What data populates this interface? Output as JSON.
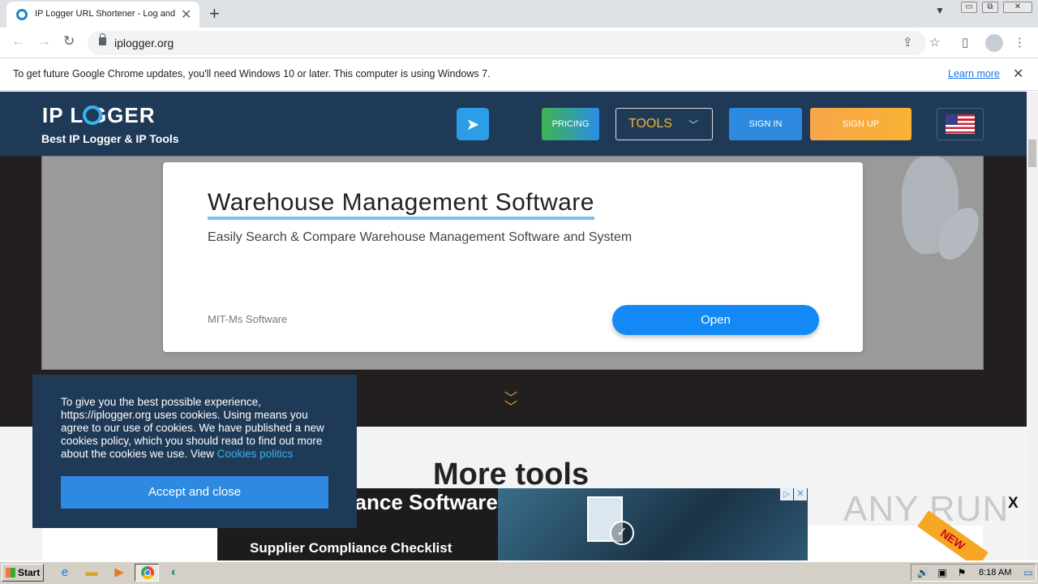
{
  "browser": {
    "tab_title": "IP Logger URL Shortener - Log and T",
    "tab_close": "✕",
    "new_tab": "+",
    "url": "iplogger.org",
    "window_controls": {
      "minimize": "▭",
      "restore": "⧉",
      "close": "✕"
    }
  },
  "infobar": {
    "message": "To get future Google Chrome updates, you'll need Windows 10 or later. This computer is using Windows 7.",
    "learn_more": "Learn more",
    "close": "✕"
  },
  "site": {
    "logo": "IP L GGER",
    "tagline": "Best IP Logger & IP Tools",
    "nav": {
      "pricing": "PRICING",
      "tools": "TOOLS",
      "sign_in": "SIGN IN",
      "sign_up": "SIGN UP"
    },
    "colors": {
      "header_bg": "#1f3a57",
      "accent_blue": "#2d8ae0",
      "accent_orange": "#f7a64a",
      "tools_label": "#f2b233"
    }
  },
  "ad_card": {
    "title": "Warehouse Management Software",
    "description": "Easily Search & Compare Warehouse Management Software and System",
    "brand": "MIT-Ms Software",
    "cta": "Open"
  },
  "section": {
    "more_tools": "More tools"
  },
  "cookie": {
    "text": "To give you the best possible experience, https://iplogger.org uses cookies. Using means you agree to our use of cookies. We have published a new cookies policy, which you should read to find out more about the cookies we use. View",
    "link": "Cookies politics",
    "accept": "Accept and close"
  },
  "bottom_ad": {
    "headline": "ompliance Software",
    "subline": "Supplier Compliance Checklist",
    "close_x": "X"
  },
  "watermark": "ANY RUN",
  "ribbon": "NEW",
  "taskbar": {
    "start": "Start",
    "clock": "8:18 AM"
  }
}
